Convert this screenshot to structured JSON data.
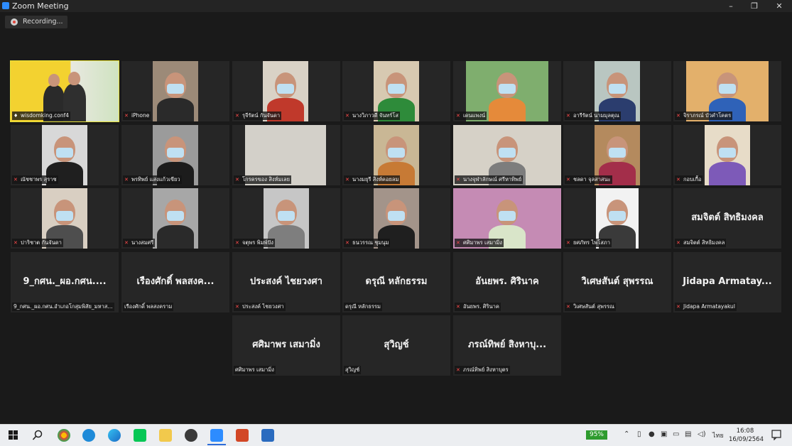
{
  "window": {
    "title": "Zoom Meeting",
    "minimize": "–",
    "restore": "❐",
    "close": "✕"
  },
  "recording": {
    "label": "Recording..."
  },
  "participants": [
    {
      "name": "wisdomking.conf4",
      "muted": false,
      "active": true,
      "video": true
    },
    {
      "name": "iPhone",
      "muted": true,
      "video": true
    },
    {
      "name": "รุจีรัตน์ กันจันดา",
      "muted": true,
      "video": true
    },
    {
      "name": "นางวิภาวดี จันทร์โส",
      "muted": true,
      "video": true
    },
    {
      "name": "เดนแพงน์",
      "muted": true,
      "video": true
    },
    {
      "name": "อารีรัตน์ นามมุลตุณ",
      "muted": true,
      "video": true
    },
    {
      "name": "จิราภรณ์ บัวคำโคตร",
      "muted": true,
      "video": true
    },
    {
      "name": "ณัชชาพร สุราช",
      "muted": true,
      "video": true
    },
    {
      "name": "พรทิพย์ แสงแก้วเขียว",
      "muted": true,
      "video": true
    },
    {
      "name": "โกรครของ สิงห์มเลย",
      "muted": true,
      "video": true
    },
    {
      "name": "นางมยุรี สิงห์คอยลม",
      "muted": true,
      "video": true
    },
    {
      "name": "นางจุฬาลักษณ์ ศรีหาทิพย์",
      "muted": true,
      "video": true
    },
    {
      "name": "ชลดา จุลสาสนะ",
      "muted": true,
      "video": true
    },
    {
      "name": "กอบเกื้อ",
      "muted": true,
      "video": true
    },
    {
      "name": "ปาริชาต กันจันดา",
      "muted": true,
      "video": true
    },
    {
      "name": "นางสมศรี",
      "muted": true,
      "video": true
    },
    {
      "name": "จตุพร พิมพ์ปัง",
      "muted": true,
      "video": true
    },
    {
      "name": "ธนวรรณ ชุมนุม",
      "muted": true,
      "video": true
    },
    {
      "name": "ศศิมาพร เสมามิ่ง",
      "muted": true,
      "video": true
    },
    {
      "name": "ยศภัทร ไพโสภา",
      "muted": true,
      "video": true
    },
    {
      "name": "สมจิตต์ สิทธิมงคล",
      "muted": true,
      "video": false,
      "display": "สมจิตต์ สิทธิมงคล"
    },
    {
      "name": "9_กศน._ผอ.กศน.อำเภอโกสุมพิสัย_มหาส...",
      "muted": false,
      "video": false,
      "display": "9_กศน._ผอ.กศน...."
    },
    {
      "name": "เรืองศักดิ์ พลสงคราม",
      "muted": false,
      "video": false,
      "display": "เรืองศักดิ์ พลสงค..."
    },
    {
      "name": "ประสงค์ ไชยวงศา",
      "muted": true,
      "video": false,
      "display": "ประสงค์ ไชยวงศา"
    },
    {
      "name": "ดรุณี หลักธรรม",
      "muted": false,
      "video": false,
      "display": "ดรุณี หลักธรรม"
    },
    {
      "name": "อันยพร. ศิรินาค",
      "muted": true,
      "video": false,
      "display": "อันยพร. ศิรินาค"
    },
    {
      "name": "วิเศษสันต์ สุพรรณ",
      "muted": true,
      "video": false,
      "display": "วิเศษสันต์ สุพรรณ"
    },
    {
      "name": "Jidapa Armatayakul",
      "muted": true,
      "video": false,
      "display": "Jidapa Armatay..."
    },
    {
      "name": "ศศิมาพร เสมามิ่ง",
      "muted": false,
      "video": false,
      "display": "ศศิมาพร เสมามิ่ง"
    },
    {
      "name": "สุวิญช์",
      "muted": false,
      "video": false,
      "display": "สุวิญช์"
    },
    {
      "name": "ภรณ์ทิพย์ สิงหาบุตร",
      "muted": true,
      "video": false,
      "display": "ภรณ์ทิพย์ สิงหาบุ..."
    }
  ],
  "taskbar": {
    "battery": "95%",
    "language": "ไทย",
    "time": "16:08",
    "date": "16/09/2564"
  }
}
